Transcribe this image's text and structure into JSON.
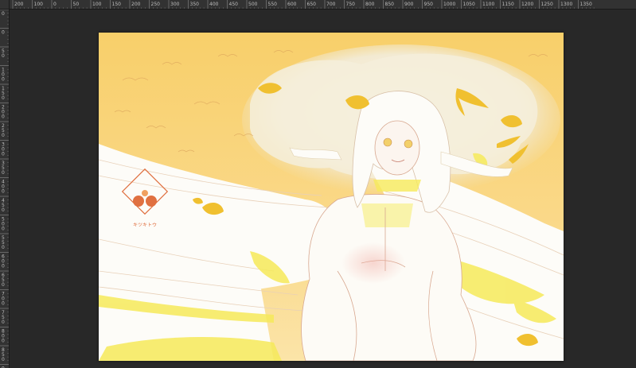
{
  "rulers": {
    "horizontal_labels": [
      "200",
      "100",
      "0",
      "50",
      "100",
      "150",
      "200",
      "250",
      "300",
      "350",
      "400",
      "450",
      "500",
      "550",
      "600",
      "650",
      "700",
      "750",
      "800",
      "850",
      "900",
      "950",
      "1000",
      "1050",
      "1100",
      "1150",
      "1200",
      "1250",
      "1300",
      "1350"
    ],
    "vertical_labels": [
      "0",
      "0",
      "50",
      "100",
      "150",
      "200",
      "250",
      "300",
      "350",
      "400",
      "450",
      "500",
      "550",
      "600",
      "650",
      "700",
      "750",
      "800",
      "850",
      "900"
    ]
  },
  "artwork": {
    "logo_text": "キツキトウ"
  },
  "colors": {
    "workspace": "#282828",
    "ruler": "#323232",
    "sky_yellow": "#f8cf6a",
    "sky_light": "#fbe9b8",
    "cloud": "#f6f0e2",
    "white_robe": "#fdfcf8",
    "accent_yellow": "#f6ea5a",
    "ginkgo": "#f0c030",
    "lineart": "#d8a890",
    "logo_orange": "#e07040"
  }
}
